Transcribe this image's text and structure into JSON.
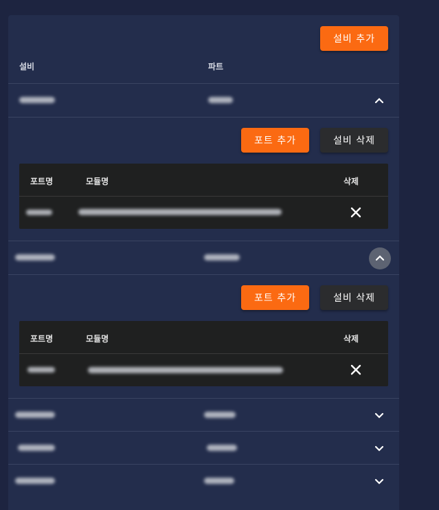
{
  "toolbar": {
    "add_equipment_label": "설비 추가"
  },
  "table": {
    "col_equipment": "설비",
    "col_part": "파트"
  },
  "expanded": [
    {
      "add_port_label": "포트 추가",
      "delete_equipment_label": "설비 삭제",
      "sub_headers": {
        "port_name": "포트명",
        "module_name": "모듈명",
        "delete": "삭제"
      }
    },
    {
      "add_port_label": "포트 추가",
      "delete_equipment_label": "설비 삭제",
      "sub_headers": {
        "port_name": "포트명",
        "module_name": "모듈명",
        "delete": "삭제"
      }
    }
  ],
  "icons": {
    "chevron_up": "chevron-up-icon",
    "chevron_down": "chevron-down-icon",
    "close": "close-icon"
  },
  "colors": {
    "accent": "#fb6a12",
    "panel": "#232d4c",
    "background": "#1d2440",
    "subtable": "#1f2020"
  }
}
